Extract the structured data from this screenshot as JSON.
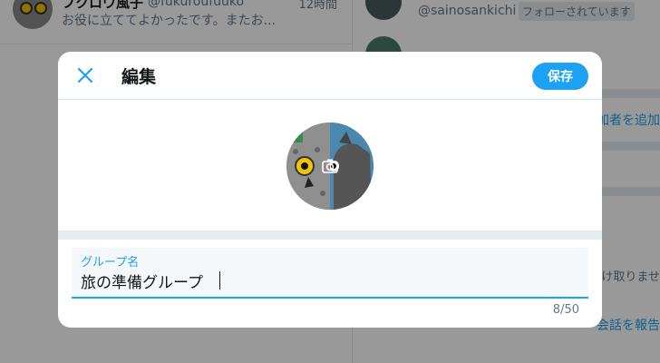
{
  "background": {
    "conversation": {
      "name": "フクロウ風子",
      "handle": "@fukuroufuuko",
      "time": "12時間",
      "preview": "お役に立ててよかったです。またお..."
    },
    "right_panel": {
      "handle": "@sainosankichi",
      "badge": "フォローされています",
      "add_participant": "加者を追加",
      "receive_text": "け取りませ",
      "report_text": "会話を報告"
    }
  },
  "modal": {
    "title": "編集",
    "save_label": "保存",
    "close_icon": "close-icon",
    "camera_icon": "camera-icon",
    "field": {
      "label": "グループ名",
      "value": "旅の準備グループ",
      "counter": "8/50"
    }
  },
  "colors": {
    "accent": "#1da1f2",
    "overlay": "rgba(0,0,0,0.4)",
    "divider": "#e6ecf0"
  }
}
